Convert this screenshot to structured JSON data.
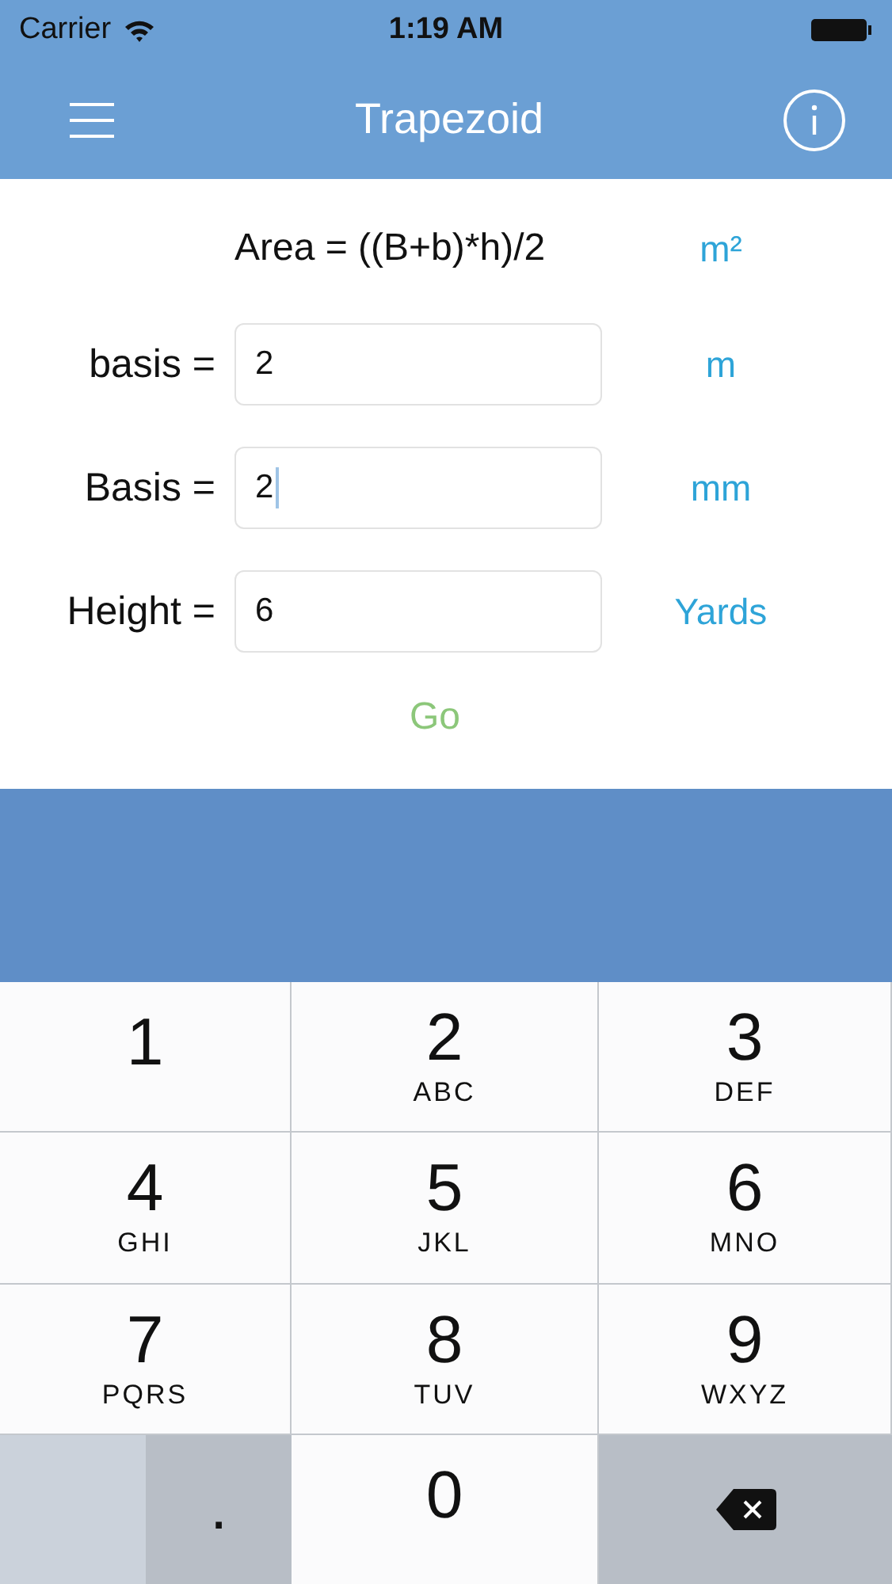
{
  "status_bar": {
    "carrier": "Carrier",
    "time": "1:19 AM"
  },
  "nav": {
    "title": "Trapezoid"
  },
  "formula": {
    "text": "Area = ((B+b)*h)/2",
    "unit": "m²"
  },
  "fields": [
    {
      "label": "basis =",
      "value": "2",
      "unit": "m",
      "focused": false
    },
    {
      "label": "Basis =",
      "value": "2",
      "unit": "mm",
      "focused": true
    },
    {
      "label": "Height =",
      "value": "6",
      "unit": "Yards",
      "focused": false
    }
  ],
  "go_button": "Go",
  "keys": [
    {
      "kind": "digit",
      "digit": "1"
    },
    {
      "kind": "digit",
      "digit": "2",
      "letters": "ABC"
    },
    {
      "kind": "digit",
      "digit": "3",
      "letters": "DEF"
    },
    {
      "kind": "digit",
      "digit": "4",
      "letters": "GHI"
    },
    {
      "kind": "digit",
      "digit": "5",
      "letters": "JKL"
    },
    {
      "kind": "digit",
      "digit": "6",
      "letters": "MNO"
    },
    {
      "kind": "digit",
      "digit": "7",
      "letters": "PQRS"
    },
    {
      "kind": "digit",
      "digit": "8",
      "letters": "TUV"
    },
    {
      "kind": "digit",
      "digit": "9",
      "letters": "WXYZ"
    },
    {
      "kind": "split",
      "digit": "."
    },
    {
      "kind": "digit",
      "digit": "0"
    },
    {
      "kind": "delete"
    }
  ]
}
